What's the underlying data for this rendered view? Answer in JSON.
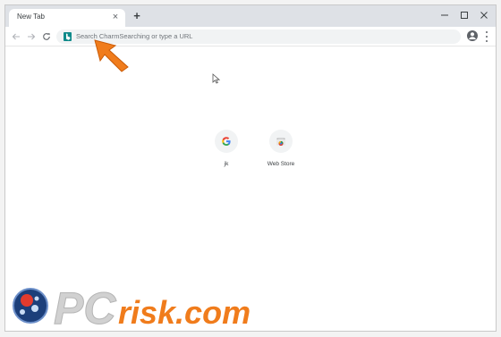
{
  "tab": {
    "title": "New Tab",
    "close_glyph": "×"
  },
  "tabstrip": {
    "new_tab_glyph": "+"
  },
  "window_controls": [
    "minimize-icon",
    "maximize-icon",
    "close-icon"
  ],
  "toolbar": {
    "back_icon": "back-arrow-icon",
    "forward_icon": "forward-arrow-icon",
    "reload_icon": "reload-icon",
    "omnibox_placeholder": "Search CharmSearching or type a URL",
    "search_engine_icon": "bing-icon",
    "bookmark_icon": "star-icon",
    "account_icon": "account-icon",
    "menu_icon": "menu-icon"
  },
  "shortcuts": [
    {
      "label": "jk",
      "icon": "google-icon"
    },
    {
      "label": "Web Store",
      "icon": "web-store-icon"
    }
  ],
  "watermark": {
    "text": "PCrisk.com",
    "left": "PC",
    "right": "risk.com"
  },
  "colors": {
    "arrow": "#f07c1c",
    "omnibox_bg": "#f1f3f4",
    "tabstrip_bg": "#dee1e6",
    "bing": "#0f8a8a"
  }
}
